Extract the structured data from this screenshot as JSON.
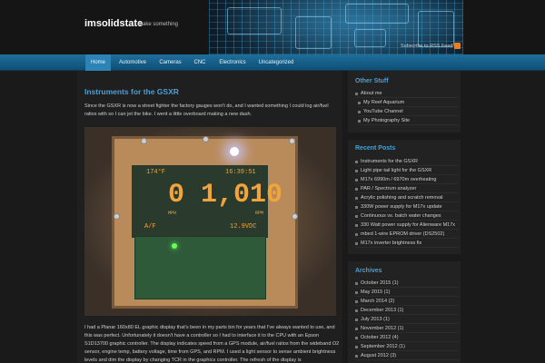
{
  "site": {
    "title": "imsolidstate",
    "description": "make something",
    "rss_label": "Subscribe to RSS Feed"
  },
  "nav": {
    "items": [
      {
        "label": "Home",
        "active": true
      },
      {
        "label": "Automotive",
        "active": false
      },
      {
        "label": "Cameras",
        "active": false
      },
      {
        "label": "CNC",
        "active": false
      },
      {
        "label": "Electronics",
        "active": false
      },
      {
        "label": "Uncategorized",
        "active": false
      }
    ]
  },
  "post": {
    "title": "Instruments for the GSXR",
    "intro": "Since the GSXR is now a street fighter the factory gauges won't do, and I wanted something I could log air/fuel ratios with so I can jet the bike. I went a little overboard making a new dash.",
    "photo_readouts": {
      "top_left": "174°F",
      "top_right": "16:39:51",
      "big_speed": "0",
      "big_rpm": "1,010",
      "afr": "A/F",
      "voltage": "12.9VDC",
      "mph_unit": "MPH",
      "rpm_unit": "RPM"
    },
    "body": "I had a Planar 160x80 EL graphic display that's been in my parts bin for years that I've always wanted to use, and this was perfect. Unfortunately it doesn't have a controller so I had to interface it to the CPU with an Epson S1D13700 graphic controller. The display indicates speed from a GPS module, air/fuel ratios from the wideband O2 sensor, engine temp, battery voltage, time from GPS, and RPM. I used a light sensor to sense ambient brightness levels and dim the display by changing TCR in the graphics controller. The refresh of the display is"
  },
  "sidebar": {
    "other_stuff": {
      "title": "Other Stuff",
      "items": [
        {
          "label": "About me",
          "sub": false
        },
        {
          "label": "My Reef Aquarium",
          "sub": true
        },
        {
          "label": "YouTube Channel",
          "sub": true
        },
        {
          "label": "My Photography Site",
          "sub": true
        }
      ]
    },
    "recent_posts": {
      "title": "Recent Posts",
      "items": [
        "Instruments for the GSXR",
        "Light pipe tail light for the GSXR",
        "M17x 6990m / 6970m overheating",
        "PAR / Spectrum analyzer",
        "Acrylic polishing and scratch removal",
        "330W power supply for M17x update",
        "Continuous vs. batch water changes",
        "330 Watt power supply for Alienware M17x",
        "mbed 1-wire EPROM driver (DS2502)",
        "M17x inverter brightness fix"
      ]
    },
    "archives": {
      "title": "Archives",
      "items": [
        "October 2015 (1)",
        "May 2015 (1)",
        "March 2014 (2)",
        "December 2013 (1)",
        "July 2013 (1)",
        "November 2012 (1)",
        "October 2012 (4)",
        "September 2012 (1)",
        "August 2012 (3)"
      ]
    }
  }
}
